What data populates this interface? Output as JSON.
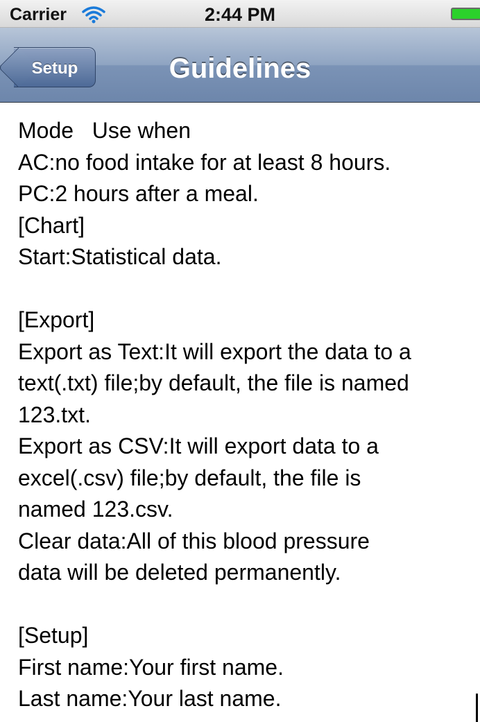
{
  "status_bar": {
    "carrier": "Carrier",
    "time": "2:44 PM"
  },
  "nav_bar": {
    "back_label": "Setup",
    "title": "Guidelines"
  },
  "guidelines": {
    "lines": [
      "Mode   Use when",
      "AC:no food intake for at least 8 hours.",
      "PC:2 hours after a meal.",
      "[Chart]",
      "Start:Statistical data.",
      "",
      "[Export]",
      "Export as Text:It will export the data to a",
      "text(.txt) file;by default, the file is named",
      "123.txt.",
      "Export as CSV:It will export data to a",
      "excel(.csv) file;by default, the file is",
      "named 123.csv.",
      "Clear data:All of this blood pressure",
      "data will be deleted permanently.",
      "",
      "[Setup]",
      "First name:Your first name.",
      "Last name:Your last name."
    ]
  },
  "colors": {
    "nav_bar": "#7b93b6",
    "battery": "#2bd12b",
    "text": "#000000"
  }
}
